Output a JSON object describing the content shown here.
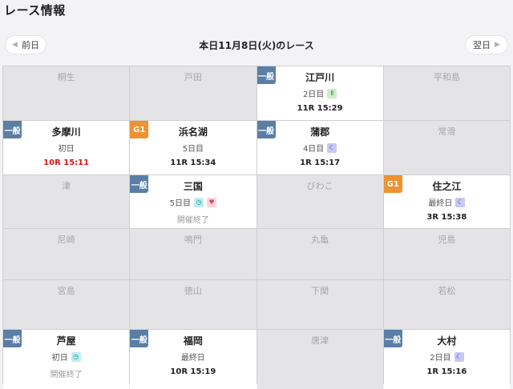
{
  "page": {
    "title": "レース情報"
  },
  "nav": {
    "prev_label": "前日",
    "next_label": "翌日",
    "date_title": "本日11月8日(火)のレース",
    "prev_arrow": "◀",
    "next_arrow": "▶"
  },
  "colors": {
    "grade_general": "#5a7ea6",
    "grade_g1": "#ee9232",
    "live_time": "#d61818"
  },
  "venues": [
    {
      "name": "桐生",
      "active": false
    },
    {
      "name": "戸田",
      "active": false
    },
    {
      "name": "江戸川",
      "active": true,
      "grade": "一般",
      "grade_type": "general",
      "day": "2日目",
      "badges": [
        {
          "icon": "rookie-icon",
          "glyph": "Ⅱ"
        }
      ],
      "status": "11R 15:29",
      "status_type": "time"
    },
    {
      "name": "平和島",
      "active": false
    },
    {
      "name": "多摩川",
      "active": true,
      "grade": "一般",
      "grade_type": "general",
      "day": "初日",
      "badges": [],
      "status": "10R 15:11",
      "status_type": "red"
    },
    {
      "name": "浜名湖",
      "active": true,
      "grade": "G1",
      "grade_type": "g1",
      "day": "5日目",
      "badges": [],
      "status": "11R 15:34",
      "status_type": "time"
    },
    {
      "name": "蒲郡",
      "active": true,
      "grade": "一般",
      "grade_type": "general",
      "day": "4日目",
      "badges": [
        {
          "icon": "night-moon-icon",
          "glyph": "☾"
        }
      ],
      "status": "1R 15:17",
      "status_type": "time"
    },
    {
      "name": "常滑",
      "active": false
    },
    {
      "name": "津",
      "active": false
    },
    {
      "name": "三国",
      "active": true,
      "grade": "一般",
      "grade_type": "general",
      "day": "5日目",
      "badges": [
        {
          "icon": "morning-clock-icon",
          "glyph": "◷"
        },
        {
          "icon": "lady-heart-icon",
          "glyph": "♥"
        }
      ],
      "status": "開催終了",
      "status_type": "finished"
    },
    {
      "name": "びわこ",
      "active": false
    },
    {
      "name": "住之江",
      "active": true,
      "grade": "G1",
      "grade_type": "g1",
      "day": "最終日",
      "badges": [
        {
          "icon": "night-moon-icon",
          "glyph": "☾"
        }
      ],
      "status": "3R 15:38",
      "status_type": "time"
    },
    {
      "name": "尼崎",
      "active": false
    },
    {
      "name": "鳴門",
      "active": false
    },
    {
      "name": "丸亀",
      "active": false
    },
    {
      "name": "児島",
      "active": false
    },
    {
      "name": "宮島",
      "active": false
    },
    {
      "name": "徳山",
      "active": false
    },
    {
      "name": "下関",
      "active": false
    },
    {
      "name": "若松",
      "active": false
    },
    {
      "name": "芦屋",
      "active": true,
      "grade": "一般",
      "grade_type": "general",
      "day": "初日",
      "badges": [
        {
          "icon": "morning-clock-icon",
          "glyph": "◷"
        }
      ],
      "status": "開催終了",
      "status_type": "finished"
    },
    {
      "name": "福岡",
      "active": true,
      "grade": "一般",
      "grade_type": "general",
      "day": "最終日",
      "badges": [],
      "status": "10R 15:19",
      "status_type": "time"
    },
    {
      "name": "唐津",
      "active": false
    },
    {
      "name": "大村",
      "active": true,
      "grade": "一般",
      "grade_type": "general",
      "day": "2日目",
      "badges": [
        {
          "icon": "night-moon-icon",
          "glyph": "☾"
        }
      ],
      "status": "1R 15:16",
      "status_type": "time"
    }
  ]
}
